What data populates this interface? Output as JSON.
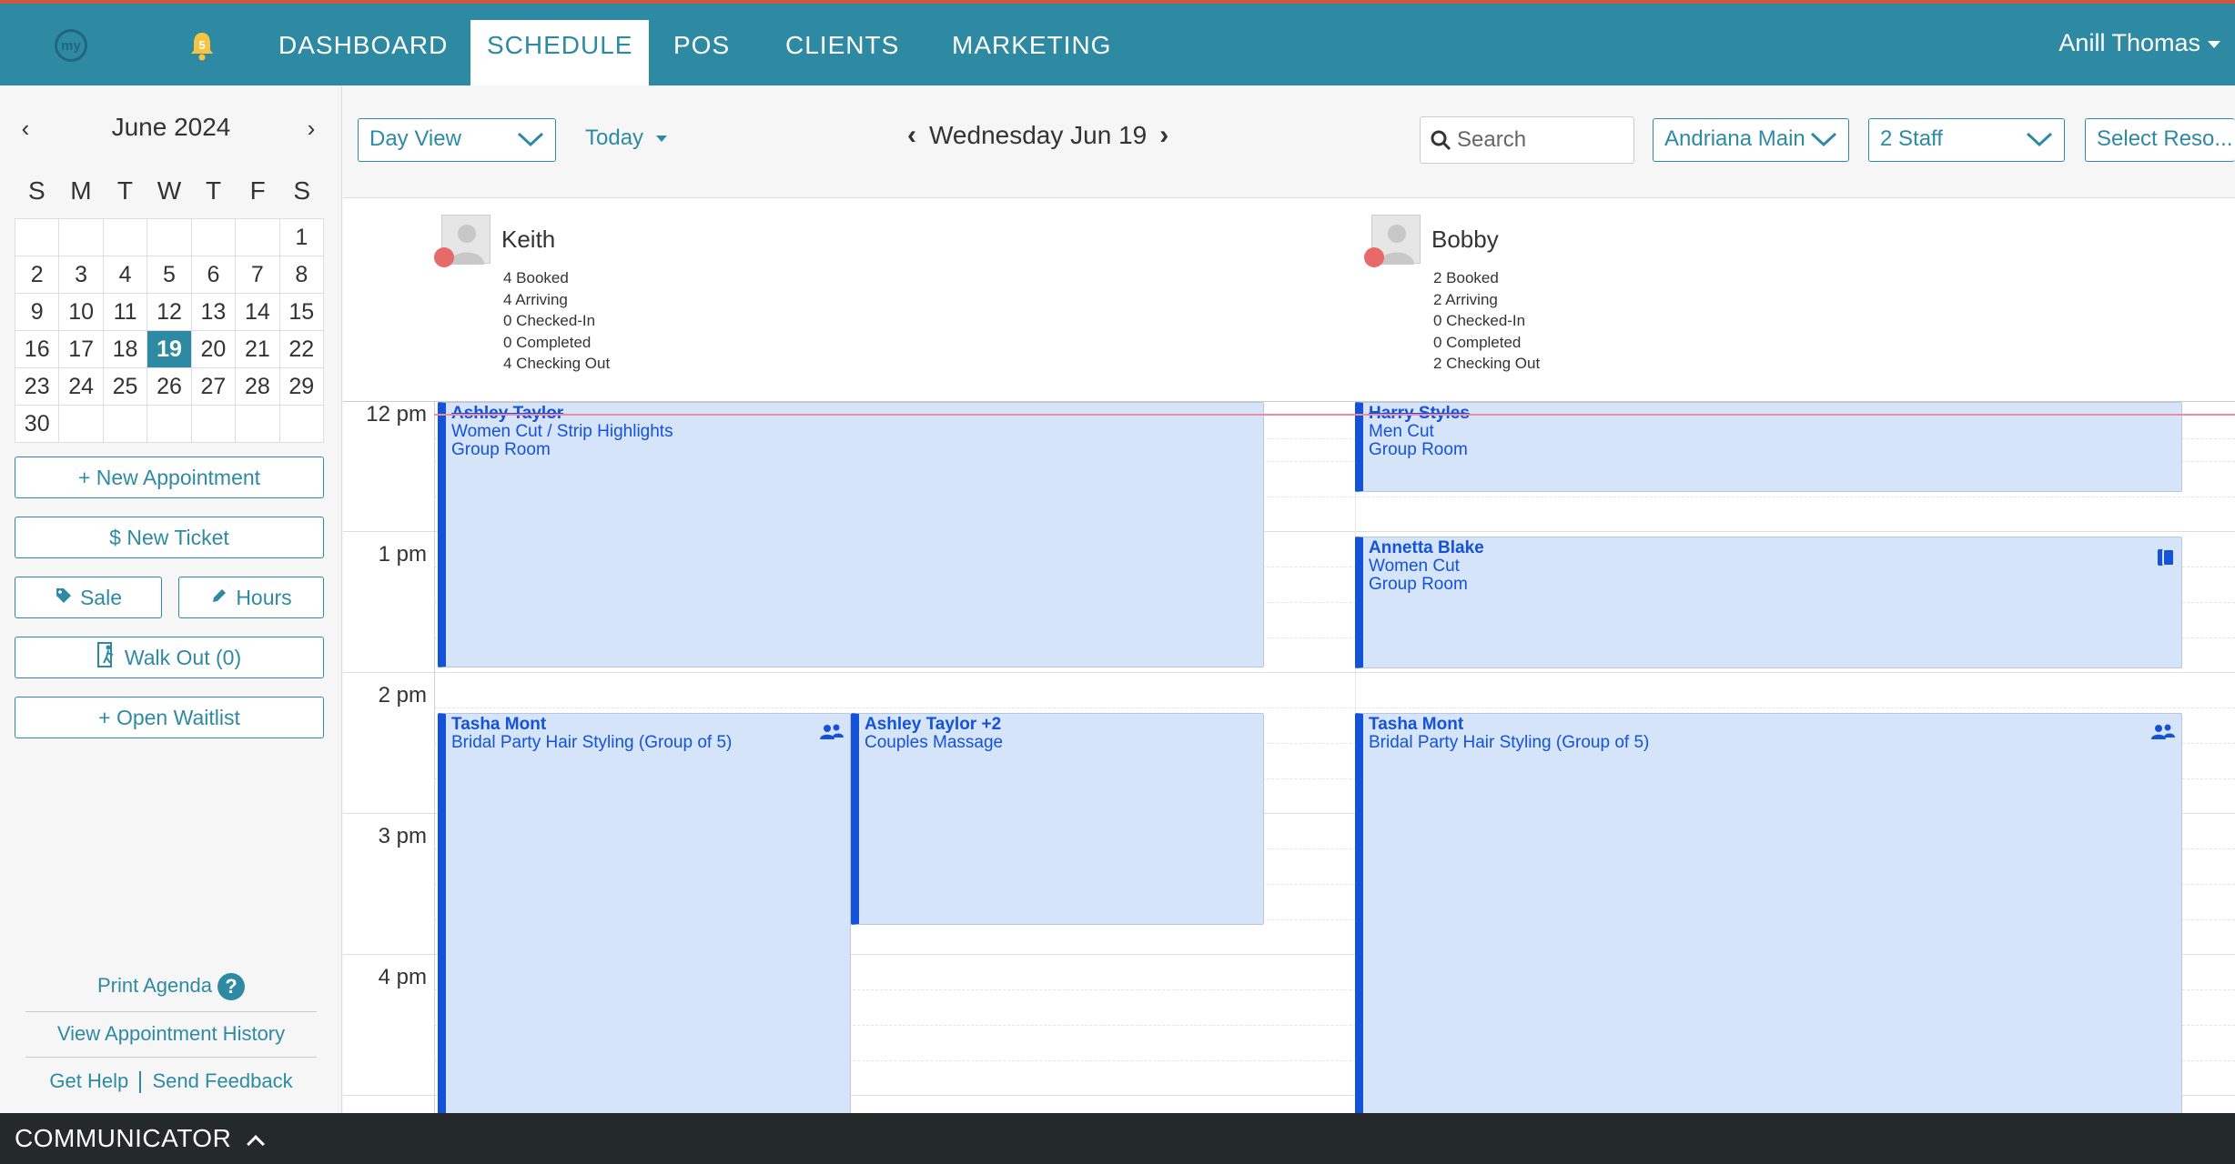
{
  "nav": {
    "logo_text": "my",
    "bell_badge": "5",
    "items": [
      "DASHBOARD",
      "SCHEDULE",
      "POS",
      "CLIENTS",
      "MARKETING"
    ],
    "active": "SCHEDULE",
    "user": "Anill Thomas"
  },
  "calendar": {
    "month": "June 2024",
    "dow": [
      "S",
      "M",
      "T",
      "W",
      "T",
      "F",
      "S"
    ],
    "selected_day": "19",
    "cells": [
      "",
      "",
      "",
      "",
      "",
      "",
      "1",
      "2",
      "3",
      "4",
      "5",
      "6",
      "7",
      "8",
      "9",
      "10",
      "11",
      "12",
      "13",
      "14",
      "15",
      "16",
      "17",
      "18",
      "19",
      "20",
      "21",
      "22",
      "23",
      "24",
      "25",
      "26",
      "27",
      "28",
      "29",
      "30",
      "",
      "",
      "",
      "",
      "",
      ""
    ]
  },
  "sidebar": {
    "new_appointment": "+ New Appointment",
    "new_ticket": "$  New Ticket",
    "sale": "Sale",
    "hours": "Hours",
    "walk_out": "Walk Out (0)",
    "open_waitlist": "+ Open Waitlist",
    "print_agenda": "Print Agenda",
    "view_history": "View Appointment History",
    "get_help": "Get Help",
    "send_feedback": "Send Feedback"
  },
  "toolbar": {
    "view": "Day View",
    "today": "Today",
    "weekday": "Wednesday",
    "date": "Jun 19",
    "search_placeholder": "Search",
    "location": "Andriana Main",
    "staff": "2 Staff",
    "resource": "Select Reso..."
  },
  "staff": [
    {
      "name": "Keith",
      "stats": [
        "4 Booked",
        "4 Arriving",
        "0 Checked-In",
        "0 Completed",
        "4 Checking Out"
      ]
    },
    {
      "name": "Bobby",
      "stats": [
        "2 Booked",
        "2 Arriving",
        "0 Checked-In",
        "0 Completed",
        "2 Checking Out"
      ]
    }
  ],
  "hours": [
    "12 pm",
    "1 pm",
    "2 pm",
    "3 pm",
    "4 pm"
  ],
  "appointments": [
    {
      "client": "Ashley Taylor",
      "service": "Women Cut / Strip Highlights",
      "room": "Group Room"
    },
    {
      "client": "Tasha Mont",
      "service": "Bridal Party Hair Styling (Group of 5)",
      "room": ""
    },
    {
      "client": "Ashley Taylor +2",
      "service": "Couples Massage",
      "room": ""
    },
    {
      "client": "Harry Styles",
      "service": "Men Cut",
      "room": "Group Room"
    },
    {
      "client": "Annetta Blake",
      "service": "Women Cut",
      "room": "Group Room"
    },
    {
      "client": "Tasha Mont",
      "service": "Bridal Party Hair Styling (Group of 5)",
      "room": ""
    }
  ],
  "communicator": "COMMUNICATOR",
  "colors": {
    "brand": "#2e8aa3",
    "appt_border": "#1452d8",
    "appt_bg": "#d6e4fa",
    "accent_top": "#d0593d"
  }
}
